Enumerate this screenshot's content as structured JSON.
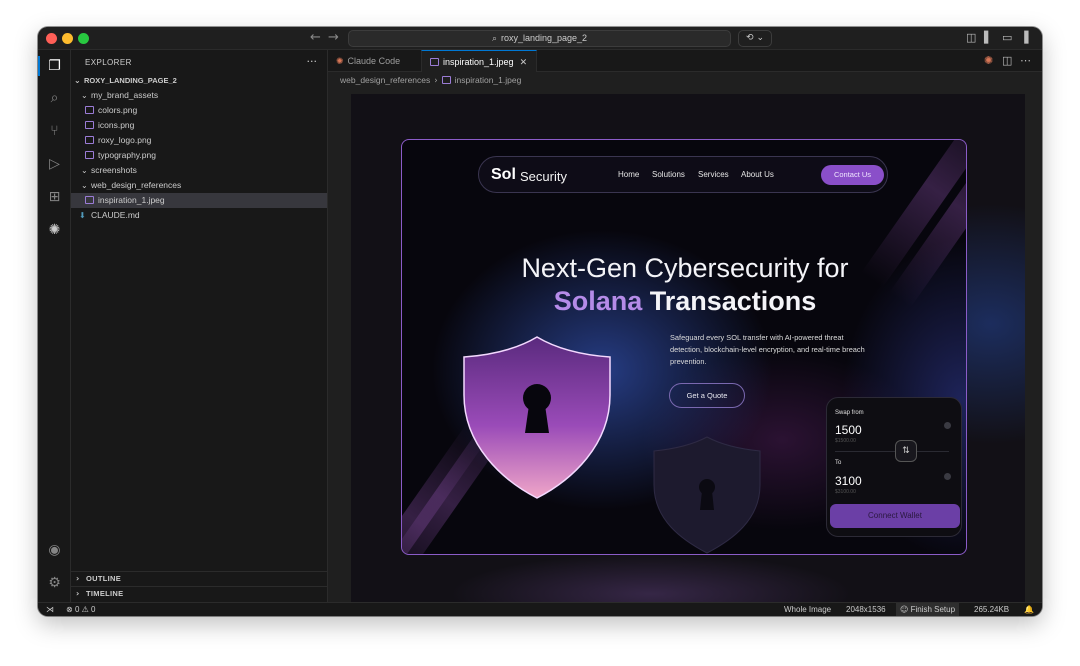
{
  "titlebar": {
    "search_text": "roxy_landing_page_2",
    "back_icon": "arrow-left-icon",
    "forward_icon": "arrow-right-icon"
  },
  "sidebar": {
    "title": "EXPLORER",
    "more_label": "···",
    "project": "ROXY_LANDING_PAGE_2",
    "tree": [
      {
        "label": "my_brand_assets",
        "kind": "folder"
      },
      {
        "label": "colors.png",
        "kind": "image"
      },
      {
        "label": "icons.png",
        "kind": "image"
      },
      {
        "label": "roxy_logo.png",
        "kind": "image"
      },
      {
        "label": "typography.png",
        "kind": "image"
      },
      {
        "label": "screenshots",
        "kind": "folder"
      },
      {
        "label": "web_design_references",
        "kind": "folder"
      },
      {
        "label": "inspiration_1.jpeg",
        "kind": "image",
        "selected": true
      },
      {
        "label": "CLAUDE.md",
        "kind": "markdown"
      }
    ],
    "outline_label": "OUTLINE",
    "timeline_label": "TIMELINE"
  },
  "tabs": [
    {
      "label": "Claude Code",
      "active": false
    },
    {
      "label": "inspiration_1.jpeg",
      "active": true
    }
  ],
  "breadcrumb": [
    "web_design_references",
    "inspiration_1.jpeg"
  ],
  "preview": {
    "logo_bold": "Sol",
    "logo_light": "Security",
    "nav_links": [
      "Home",
      "Solutions",
      "Services",
      "About Us"
    ],
    "contact_button": "Contact Us",
    "headline_line1": "Next-Gen Cybersecurity for",
    "headline_accent": "Solana",
    "headline_rest": "Transactions",
    "description": "Safeguard every SOL transfer with AI-powered threat detection, blockchain-level encryption, and real-time breach prevention.",
    "cta_button": "Get a Quote",
    "wallet": {
      "from_label": "Swap from",
      "from_value": "1500",
      "from_sub": "$1500.00",
      "to_label": "To",
      "to_value": "3100",
      "to_sub": "$3100.00",
      "connect_button": "Connect Wallet"
    }
  },
  "status": {
    "errors": "0",
    "warnings": "0",
    "view_mode": "Whole Image",
    "dimensions": "2048x1536",
    "finish_setup": "Finish Setup",
    "file_size": "265.24KB"
  },
  "colors": {
    "accent": "#8a4fc9",
    "editor_bg": "#1f1f1f",
    "sidebar_bg": "#181818",
    "selection": "#37373d"
  }
}
